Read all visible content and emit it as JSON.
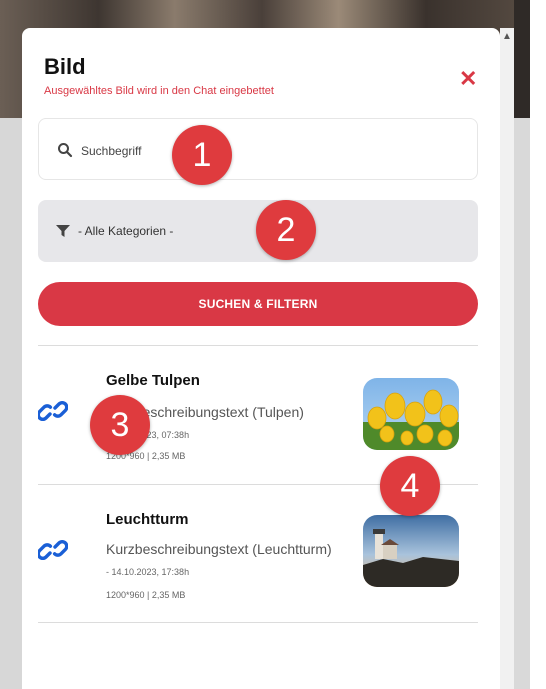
{
  "dialog": {
    "title": "Bild",
    "subtitle": "Ausgewähltes Bild wird in den Chat eingebettet",
    "close_icon": "close-icon",
    "accent": "#d93845"
  },
  "search": {
    "placeholder": "Suchbegriff",
    "icon": "search-icon"
  },
  "category": {
    "selected": "- Alle Kategorien -",
    "icon": "filter-icon"
  },
  "submit": {
    "label": "SUCHEN & FILTERN"
  },
  "results": [
    {
      "title": "Gelbe Tulpen",
      "description": "Kurzbeschreibungstext (Tulpen)",
      "date": " - 14.10.2023, 07:38h",
      "meta": "1200*960 | 2,35 MB",
      "icon": "link-icon"
    },
    {
      "title": "Leuchtturm",
      "description": "Kurzbeschreibungstext (Leuchtturm)",
      "date": " - 14.10.2023, 17:38h",
      "meta": "1200*960 | 2,35 MB",
      "icon": "link-icon"
    }
  ],
  "callouts": [
    "1",
    "2",
    "3",
    "4"
  ]
}
